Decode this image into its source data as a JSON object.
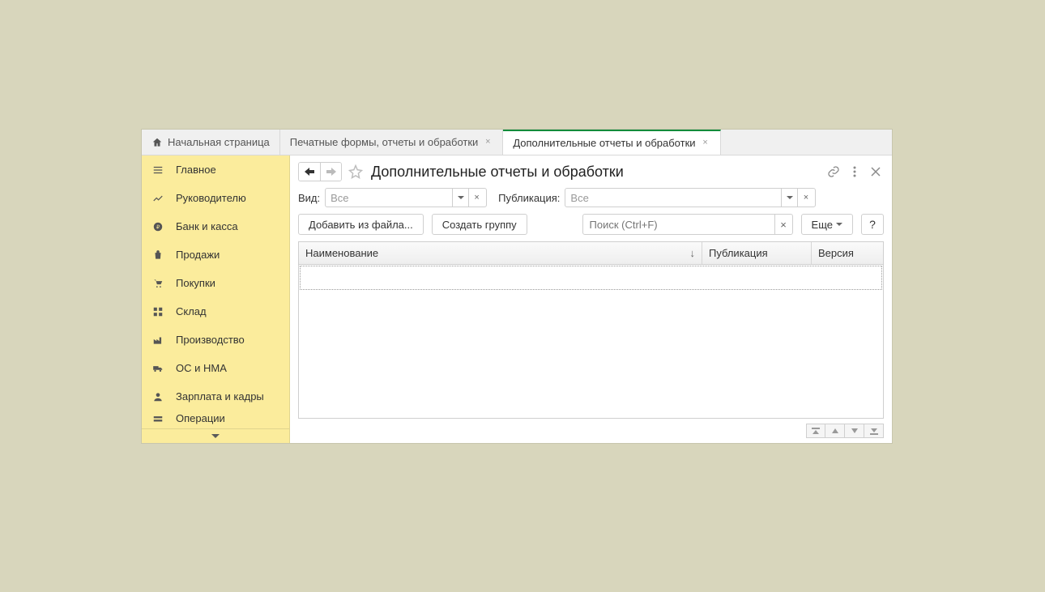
{
  "tabs": {
    "home": "Начальная страница",
    "tab1": "Печатные формы, отчеты и обработки",
    "tab2": "Дополнительные отчеты и обработки"
  },
  "sidebar": {
    "items": [
      {
        "label": "Главное"
      },
      {
        "label": "Руководителю"
      },
      {
        "label": "Банк и касса"
      },
      {
        "label": "Продажи"
      },
      {
        "label": "Покупки"
      },
      {
        "label": "Склад"
      },
      {
        "label": "Производство"
      },
      {
        "label": "ОС и НМА"
      },
      {
        "label": "Зарплата и кадры"
      },
      {
        "label": "Операции"
      }
    ]
  },
  "page": {
    "title": "Дополнительные отчеты и обработки"
  },
  "filters": {
    "kind_label": "Вид:",
    "kind_value": "Все",
    "pub_label": "Публикация:",
    "pub_value": "Все"
  },
  "toolbar": {
    "add_from_file": "Добавить из файла...",
    "create_group": "Создать группу",
    "search_placeholder": "Поиск (Ctrl+F)",
    "more": "Еще",
    "help": "?"
  },
  "table": {
    "col_name": "Наименование",
    "col_pub": "Публикация",
    "col_ver": "Версия"
  }
}
